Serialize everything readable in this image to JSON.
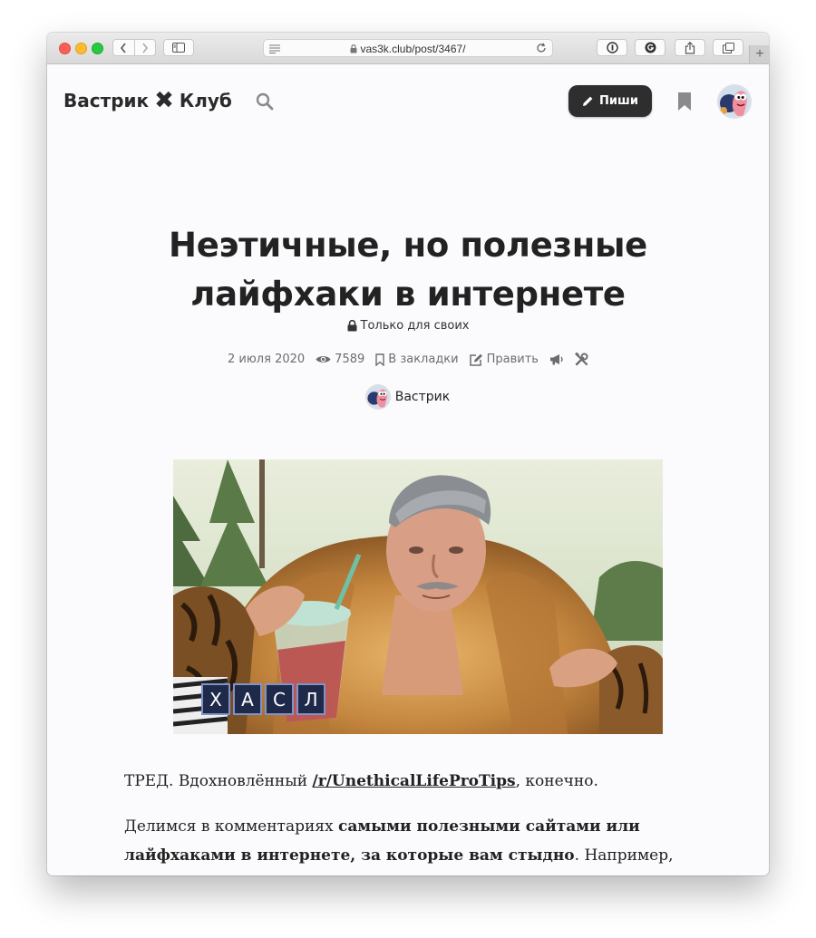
{
  "browser": {
    "url": "vas3k.club/post/3467/",
    "new_tab": "+"
  },
  "header": {
    "brand_left": "Вастрик",
    "brand_right": "Клуб",
    "write_label": "Пиши"
  },
  "post": {
    "title_line1": "Неэтичные, но полезные",
    "title_line2": "лайфхаки в интернете",
    "visibility": "Только для своих",
    "date": "2 июля 2020",
    "views": "7589",
    "bookmark_label": "В закладки",
    "edit_label": "Править",
    "author": "Вастрик",
    "cover_caption_letters": [
      "Х",
      "А",
      "С",
      "Л"
    ]
  },
  "content": {
    "p1_before": "ТРЕД. Вдохновлённый ",
    "p1_link": "/r/UnethicalLifeProTips",
    "p1_after": ", конечно.",
    "p2_before": "Делимся в комментариях ",
    "p2_bold": "самыми полезными сайтами или лайфхаками в интернете, за которые вам стыдно",
    "p2_after": ". Например,"
  },
  "colors": {
    "page_bg": "#fbfbfd",
    "button_dark": "#2e2e2e",
    "text": "#222222",
    "meta": "#6d6d6d"
  }
}
